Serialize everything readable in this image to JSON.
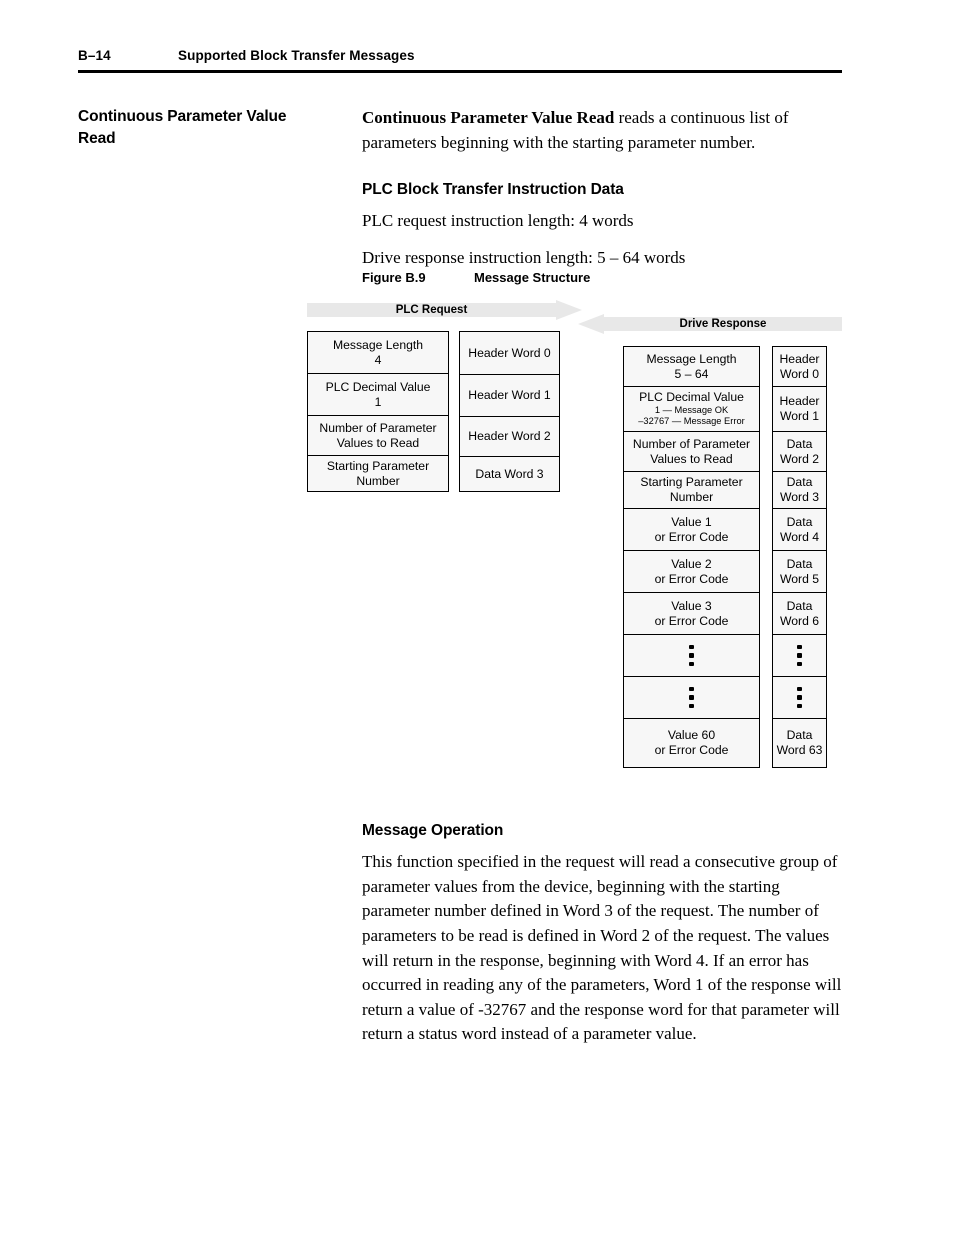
{
  "header": {
    "page_number": "B–14",
    "title": "Supported Block Transfer Messages"
  },
  "margin_heading": "Continuous Parameter Value Read",
  "intro": {
    "lead": "Continuous Parameter Value Read",
    "rest": " reads a continuous list of parameters beginning with the starting parameter number."
  },
  "section_plc": {
    "heading": "PLC Block Transfer Instruction Data",
    "request_length": "PLC request instruction length: 4 words",
    "response_length": "Drive response instruction length: 5 – 64 words"
  },
  "figure": {
    "number": "Figure B.9",
    "title": "Message Structure",
    "request_banner": "PLC Request",
    "response_banner": "Drive Response",
    "request_rows": [
      {
        "label": "Message Length",
        "value": "4"
      },
      {
        "label": "PLC Decimal Value",
        "value": "1"
      },
      {
        "label": "Number of Parameter",
        "value": "Values to Read"
      },
      {
        "label": "Starting Parameter",
        "value": "Number"
      }
    ],
    "request_words": [
      "Header Word 0",
      "Header Word 1",
      "Header Word 2",
      "Data Word 3"
    ],
    "response_rows": [
      {
        "label": "Message Length",
        "value": "5 – 64"
      },
      {
        "label": "PLC Decimal Value",
        "sub1": "1 — Message OK",
        "sub2": "–32767 — Message Error"
      },
      {
        "label": "Number of Parameter",
        "value": "Values to Read"
      },
      {
        "label": "Starting Parameter",
        "value": "Number"
      },
      {
        "label": "Value 1",
        "value": "or Error Code"
      },
      {
        "label": "Value 2",
        "value": "or Error Code"
      },
      {
        "label": "Value 3",
        "value": "or Error Code"
      },
      {
        "ellipsis": true
      },
      {
        "ellipsis": true
      },
      {
        "label": "Value 60",
        "value": "or Error Code"
      }
    ],
    "response_words": [
      {
        "line1": "Header",
        "line2": "Word 0"
      },
      {
        "line1": "Header",
        "line2": "Word 1"
      },
      {
        "line1": "Data",
        "line2": "Word 2"
      },
      {
        "line1": "Data",
        "line2": "Word 3"
      },
      {
        "line1": "Data",
        "line2": "Word 4"
      },
      {
        "line1": "Data",
        "line2": "Word 5"
      },
      {
        "line1": "Data",
        "line2": "Word 6"
      },
      {
        "ellipsis": true
      },
      {
        "ellipsis": true
      },
      {
        "line1": "Data",
        "line2": "Word 63"
      }
    ]
  },
  "section_operation": {
    "heading": "Message Operation",
    "body": "This function specified in the request will read a consecutive group of parameter values from the device, beginning with the starting parameter number defined in Word 3 of the request. The number of parameters to be read is defined in Word 2 of the request. The values will return in the response, beginning with Word 4. If an error has occurred in reading any of the parameters, Word 1 of the response will return a value of -32767 and the response word for that parameter will return a status word instead of a parameter value."
  }
}
